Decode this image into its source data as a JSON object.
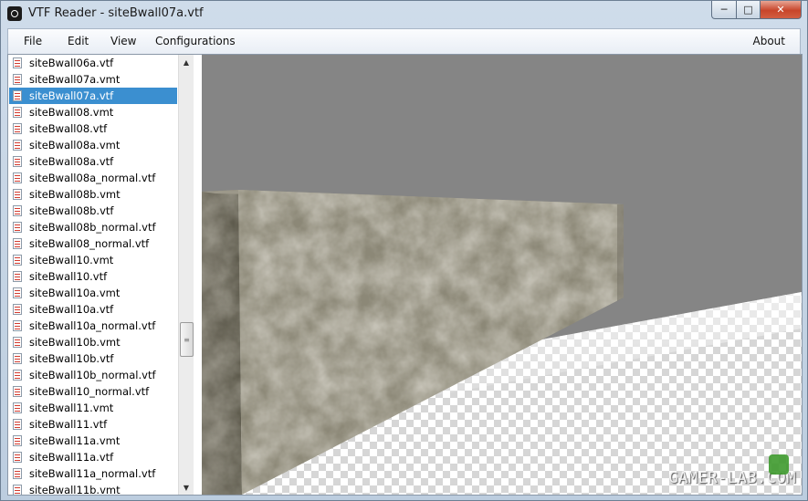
{
  "window": {
    "title": "VTF Reader - siteBwall07a.vtf",
    "controls": {
      "minimize": "─",
      "maximize": "□",
      "close": "✕"
    }
  },
  "menu": {
    "file": "File",
    "edit": "Edit",
    "view": "View",
    "configurations": "Configurations",
    "about": "About"
  },
  "files": [
    "siteBwall06a.vtf",
    "siteBwall07a.vmt",
    "siteBwall07a.vtf",
    "siteBwall08.vmt",
    "siteBwall08.vtf",
    "siteBwall08a.vmt",
    "siteBwall08a.vtf",
    "siteBwall08a_normal.vtf",
    "siteBwall08b.vmt",
    "siteBwall08b.vtf",
    "siteBwall08b_normal.vtf",
    "siteBwall08_normal.vtf",
    "siteBwall10.vmt",
    "siteBwall10.vtf",
    "siteBwall10a.vmt",
    "siteBwall10a.vtf",
    "siteBwall10a_normal.vtf",
    "siteBwall10b.vmt",
    "siteBwall10b.vtf",
    "siteBwall10b_normal.vtf",
    "siteBwall10_normal.vtf",
    "siteBwall11.vmt",
    "siteBwall11.vtf",
    "siteBwall11a.vmt",
    "siteBwall11a.vtf",
    "siteBwall11a_normal.vtf",
    "siteBwall11b.vmt"
  ],
  "selected_file": "siteBwall07a.vtf",
  "scrollbar": {
    "up": "▲",
    "down": "▼",
    "grip": "≡"
  },
  "watermark": "GAMER-LAB.COM",
  "colors": {
    "selection": "#3b8fd0",
    "viewport_sky": "#858585",
    "checker_light": "#ffffff",
    "checker_dark": "#d6d6d6",
    "concrete": "#8d8a78"
  }
}
